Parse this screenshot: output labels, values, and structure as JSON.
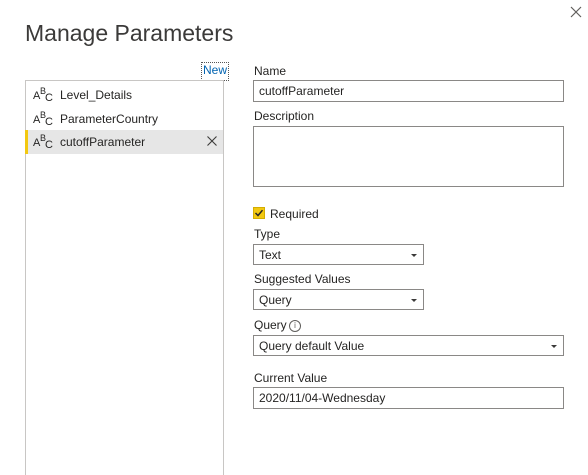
{
  "dialog": {
    "title": "Manage Parameters",
    "new_link": "New"
  },
  "parameters": [
    {
      "name": "Level_Details",
      "type_icon": "abc-text-icon",
      "selected": false
    },
    {
      "name": "ParameterCountry",
      "type_icon": "abc-text-icon",
      "selected": false
    },
    {
      "name": "cutoffParameter",
      "type_icon": "abc-text-icon",
      "selected": true
    }
  ],
  "form": {
    "name_label": "Name",
    "name_value": "cutoffParameter",
    "description_label": "Description",
    "description_value": "",
    "required_label": "Required",
    "required_checked": true,
    "type_label": "Type",
    "type_value": "Text",
    "suggested_values_label": "Suggested Values",
    "suggested_values_value": "Query",
    "query_label": "Query",
    "query_value": "Query default Value",
    "current_value_label": "Current Value",
    "current_value": "2020/11/04-Wednesday"
  },
  "colors": {
    "accent": "#f2c811",
    "link": "#0063b1",
    "selected_bg": "#e6e6e6"
  }
}
